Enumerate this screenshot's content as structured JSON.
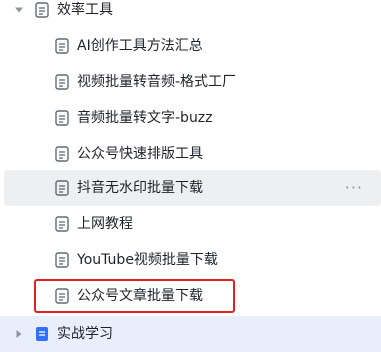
{
  "folder": {
    "label": "效率工具",
    "expanded": true
  },
  "items": [
    {
      "label": "AI创作工具方法汇总"
    },
    {
      "label": "视频批量转音频-格式工厂"
    },
    {
      "label": "音频批量转文字-buzz"
    },
    {
      "label": "公众号快速排版工具"
    },
    {
      "label": "抖音无水印批量下载",
      "more": "···"
    },
    {
      "label": "上网教程"
    },
    {
      "label": "YouTube视频批量下载"
    },
    {
      "label": "公众号文章批量下载"
    }
  ],
  "next_folder": {
    "label": "实战学习"
  },
  "colors": {
    "icon_gray": "#646a73",
    "arrow_gray": "#8f959e",
    "highlight_red": "#e02020",
    "hover_bg": "#eeeff1",
    "blue_icon": "#3370ff"
  }
}
